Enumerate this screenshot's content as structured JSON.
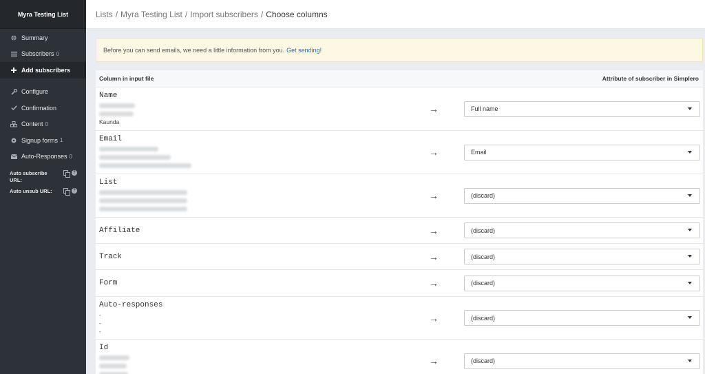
{
  "sidebar": {
    "list_name": "Myra Testing List",
    "items": [
      {
        "label": "Summary",
        "count": "",
        "icon": "globe-icon"
      },
      {
        "label": "Subscribers",
        "count": "0",
        "icon": "list-icon"
      },
      {
        "label": "Add subscribers",
        "count": "",
        "icon": "plus-icon",
        "active": true
      },
      {
        "label": "Configure",
        "count": "",
        "icon": "wrench-icon"
      },
      {
        "label": "Confirmation",
        "count": "",
        "icon": "check-icon"
      },
      {
        "label": "Content",
        "count": "0",
        "icon": "cubes-icon"
      },
      {
        "label": "Signup forms",
        "count": "1",
        "icon": "circle-icon"
      },
      {
        "label": "Auto-Responses",
        "count": "0",
        "icon": "envelope-icon"
      }
    ],
    "auto_subscribe_label": "Auto subscribe URL:",
    "auto_unsub_label": "Auto unsub URL:"
  },
  "breadcrumb": {
    "items": [
      "Lists",
      "Myra Testing List",
      "Import subscribers"
    ],
    "separator": "/",
    "current": "Choose columns"
  },
  "notice": {
    "text": "Before you can send emails, we need a little information from you.",
    "link": "Get sending!"
  },
  "table": {
    "header_left": "Column in input file",
    "header_right": "Attribute of subscriber in Simplero",
    "arrow": "→",
    "rows": [
      {
        "name": "Name",
        "samples": [
          "",
          "",
          "Kaunda"
        ],
        "mapping": "Full name"
      },
      {
        "name": "Email",
        "samples": [
          "",
          "",
          ""
        ],
        "mapping": "Email"
      },
      {
        "name": "List",
        "samples": [
          "",
          "",
          ""
        ],
        "mapping": "(discard)"
      },
      {
        "name": "Affiliate",
        "samples": [],
        "mapping": "(discard)"
      },
      {
        "name": "Track",
        "samples": [],
        "mapping": "(discard)"
      },
      {
        "name": "Form",
        "samples": [],
        "mapping": "(discard)"
      },
      {
        "name": "Auto-responses",
        "samples": [
          "-",
          "-",
          "-"
        ],
        "mapping": "(discard)"
      },
      {
        "name": "Id",
        "samples": [
          "",
          "",
          ""
        ],
        "mapping": "(discard)"
      }
    ]
  },
  "colors": {
    "sidebar_bg": "#2d3238",
    "notice_bg": "#fcf8e3",
    "link": "#2a6fb0"
  }
}
